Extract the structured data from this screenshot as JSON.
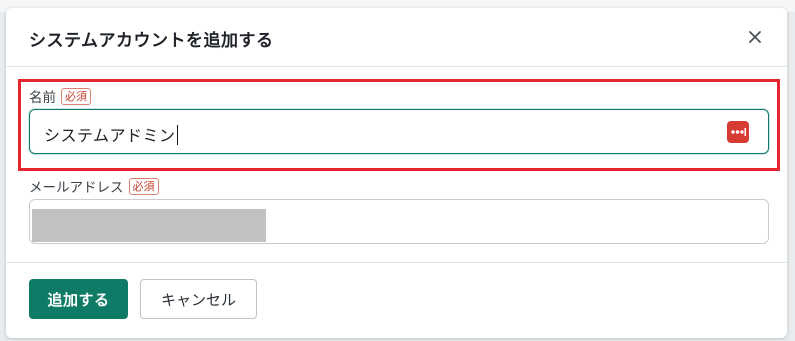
{
  "dialog": {
    "title": "システムアカウントを追加する",
    "close_icon": "close-icon"
  },
  "form": {
    "name_field": {
      "label": "名前",
      "required_badge": "必須",
      "value": "システムアドミン",
      "has_focus": true,
      "trailing_icon": "password-manager-icon"
    },
    "email_field": {
      "label": "メールアドレス",
      "required_badge": "必須",
      "value_redacted": true
    }
  },
  "footer": {
    "submit_label": "追加する",
    "cancel_label": "キャンセル"
  },
  "colors": {
    "primary": "#0d7b66",
    "highlight_border": "#e3252e",
    "required_badge": "#c6412f",
    "password_icon_bg": "#d63c31"
  }
}
